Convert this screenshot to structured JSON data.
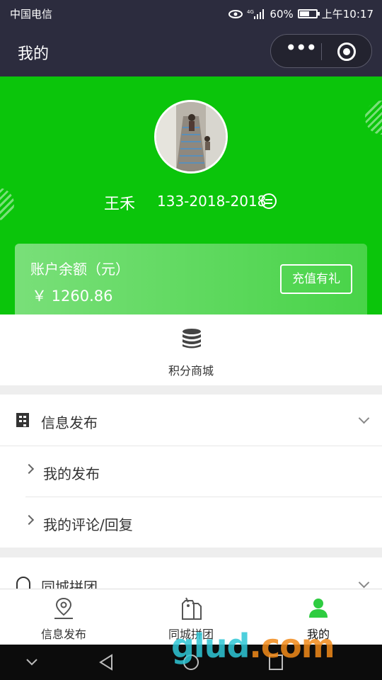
{
  "status_bar": {
    "carrier": "中国电信",
    "battery": "60%",
    "time": "上午10:17",
    "battery_level": 0.6
  },
  "title_bar": {
    "title": "我的",
    "more_icon": "more-dots-icon",
    "close_icon": "target-icon"
  },
  "profile": {
    "name": "王禾",
    "phone": "133-2018-2018",
    "switch_icon": "switch-icon",
    "accent_color": "#0bc50b"
  },
  "balance": {
    "label": "账户余额（元）",
    "value": "￥ 1260.86",
    "recharge_button": "充值有礼"
  },
  "points_mall": {
    "label": "积分商城",
    "icon": "coins-stack-icon"
  },
  "menu": {
    "section1": {
      "title": "信息发布",
      "items": [
        "我的发布",
        "我的评论/回复"
      ]
    },
    "section2": {
      "title": "同城拼团"
    }
  },
  "tabbar": {
    "tabs": [
      {
        "label": "信息发布",
        "icon": "location-pin-icon"
      },
      {
        "label": "同城拼团",
        "icon": "tag-icon"
      },
      {
        "label": "我的",
        "icon": "user-icon",
        "active": true
      }
    ],
    "active_color": "#0bc50b"
  },
  "watermark": {
    "text": "glud",
    "suffix": ".com"
  }
}
